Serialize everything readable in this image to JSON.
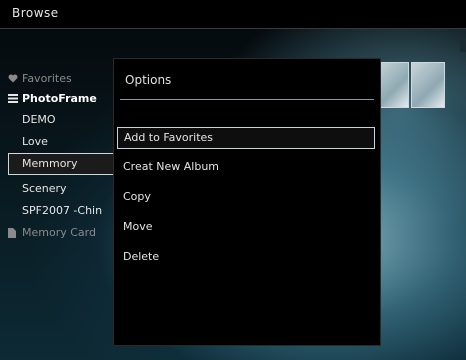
{
  "header": {
    "title": "Browse"
  },
  "albums": [
    {
      "label": "Favorites",
      "icon": "heart-icon",
      "style": "dim"
    },
    {
      "label": "PhotoFrame",
      "icon": "list-icon",
      "style": "bold"
    },
    {
      "label": "DEMO",
      "icon": "",
      "style": "normal"
    },
    {
      "label": "Love",
      "icon": "",
      "style": "normal"
    },
    {
      "label": "Memmory",
      "icon": "",
      "style": "selected"
    },
    {
      "label": "Scenery",
      "icon": "",
      "style": "normal"
    },
    {
      "label": "SPF2007 -Chin",
      "icon": "",
      "style": "normal"
    },
    {
      "label": "Memory Card",
      "icon": "memory-card-icon",
      "style": "dim"
    }
  ],
  "options_menu": {
    "title": "Options",
    "items": [
      {
        "label": "Add to Favorites",
        "selected": true
      },
      {
        "label": "Creat New Album",
        "selected": false
      },
      {
        "label": "Copy",
        "selected": false
      },
      {
        "label": "Move",
        "selected": false
      },
      {
        "label": "Delete",
        "selected": false
      }
    ]
  },
  "colors": {
    "selection_border": "#c7d4da",
    "panel_bg": "#000000",
    "accent_bg": "#6fb6c8"
  }
}
